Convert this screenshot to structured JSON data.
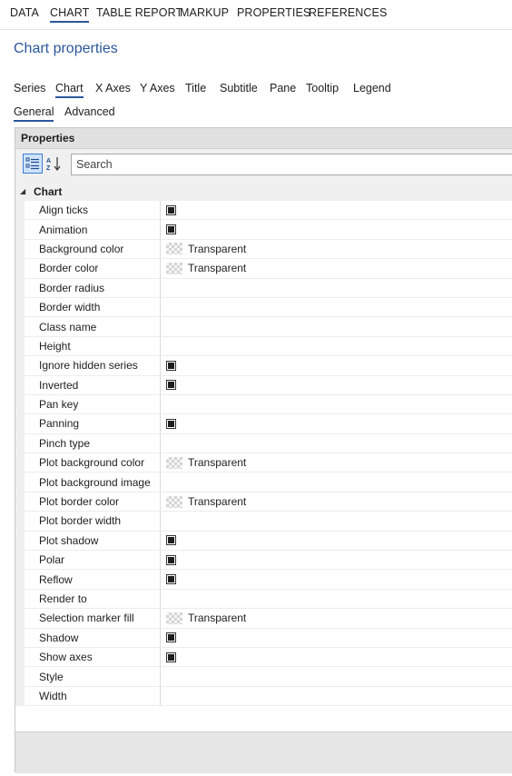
{
  "top_menu": [
    "DATA",
    "CHART",
    "TABLE REPORT",
    "MARKUP",
    "PROPERTIES",
    "REFERENCES"
  ],
  "page_title": "Chart properties",
  "section_tabs": [
    "Series",
    "Chart",
    "X Axes",
    "Y Axes",
    "Title",
    "Subtitle",
    "Pane",
    "Tooltip",
    "Legend"
  ],
  "sub_tabs": [
    "General",
    "Advanced"
  ],
  "panel": {
    "header": "Properties",
    "search_placeholder": "Search",
    "category": "Chart",
    "rows": [
      {
        "name": "Align ticks",
        "type": "checkbox",
        "value": ""
      },
      {
        "name": "Animation",
        "type": "checkbox",
        "value": ""
      },
      {
        "name": "Background color",
        "type": "color",
        "value": "Transparent"
      },
      {
        "name": "Border color",
        "type": "color",
        "value": "Transparent"
      },
      {
        "name": "Border radius",
        "type": "text",
        "value": ""
      },
      {
        "name": "Border width",
        "type": "text",
        "value": ""
      },
      {
        "name": "Class name",
        "type": "text",
        "value": ""
      },
      {
        "name": "Height",
        "type": "text",
        "value": ""
      },
      {
        "name": "Ignore hidden series",
        "type": "checkbox",
        "value": ""
      },
      {
        "name": "Inverted",
        "type": "checkbox",
        "value": ""
      },
      {
        "name": "Pan key",
        "type": "text",
        "value": ""
      },
      {
        "name": "Panning",
        "type": "checkbox",
        "value": ""
      },
      {
        "name": "Pinch type",
        "type": "text",
        "value": ""
      },
      {
        "name": "Plot background color",
        "type": "color",
        "value": "Transparent"
      },
      {
        "name": "Plot background image",
        "type": "text",
        "value": ""
      },
      {
        "name": "Plot border color",
        "type": "color",
        "value": "Transparent"
      },
      {
        "name": "Plot border width",
        "type": "text",
        "value": ""
      },
      {
        "name": "Plot shadow",
        "type": "checkbox",
        "value": ""
      },
      {
        "name": "Polar",
        "type": "checkbox",
        "value": ""
      },
      {
        "name": "Reflow",
        "type": "checkbox",
        "value": ""
      },
      {
        "name": "Render to",
        "type": "text",
        "value": ""
      },
      {
        "name": "Selection marker fill",
        "type": "color",
        "value": "Transparent"
      },
      {
        "name": "Shadow",
        "type": "checkbox",
        "value": ""
      },
      {
        "name": "Show axes",
        "type": "checkbox",
        "value": ""
      },
      {
        "name": "Style",
        "type": "text",
        "value": ""
      },
      {
        "name": "Width",
        "type": "text",
        "value": ""
      }
    ]
  },
  "icons": {
    "categorized": "categorized-sort-icon",
    "alphabetical": "alphabetical-sort-icon",
    "collapse": "collapse-triangle-icon",
    "swatch": "transparent-swatch-icon"
  },
  "colors": {
    "accent": "#2b579a",
    "panel_bg": "#f0f0f0",
    "header_bg": "#e1e1e1"
  }
}
